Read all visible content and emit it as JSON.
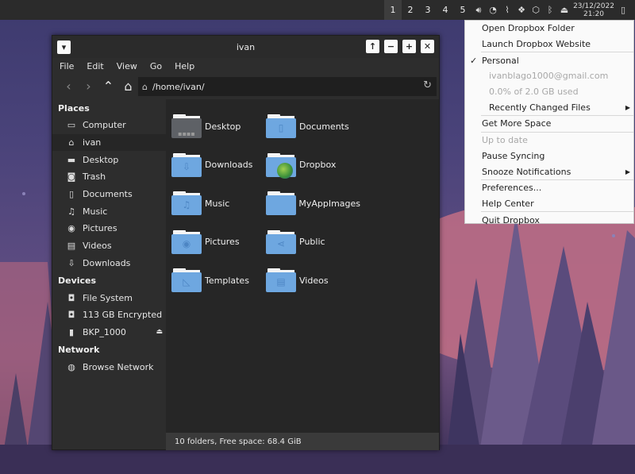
{
  "panel": {
    "workspaces": [
      "1",
      "2",
      "3",
      "4",
      "5"
    ],
    "active_workspace": "1",
    "clock_date": "23/12/2022",
    "clock_time": "21:20",
    "tray_icons": [
      "volume-icon",
      "wifi-icon",
      "paperclip-icon",
      "dropbox-icon",
      "chip-icon",
      "bluetooth-icon",
      "eject-icon",
      "battery-icon"
    ]
  },
  "window": {
    "title": "ivan",
    "menu": [
      "File",
      "Edit",
      "View",
      "Go",
      "Help"
    ],
    "path": "/home/ivan/",
    "status": "10 folders, Free space: 68.4 GiB"
  },
  "sidebar": {
    "places_heading": "Places",
    "places": [
      {
        "label": "Computer",
        "icon": "computer-icon"
      },
      {
        "label": "ivan",
        "icon": "home-icon"
      },
      {
        "label": "Desktop",
        "icon": "desktop-icon"
      },
      {
        "label": "Trash",
        "icon": "trash-icon"
      },
      {
        "label": "Documents",
        "icon": "document-icon"
      },
      {
        "label": "Music",
        "icon": "music-icon"
      },
      {
        "label": "Pictures",
        "icon": "camera-icon"
      },
      {
        "label": "Videos",
        "icon": "film-icon"
      },
      {
        "label": "Downloads",
        "icon": "download-icon"
      }
    ],
    "devices_heading": "Devices",
    "devices": [
      {
        "label": "File System",
        "icon": "drive-icon"
      },
      {
        "label": "113 GB Encrypted",
        "icon": "encrypted-drive-icon"
      },
      {
        "label": "BKP_1000",
        "icon": "usb-drive-icon"
      }
    ],
    "network_heading": "Network",
    "network": [
      {
        "label": "Browse Network",
        "icon": "network-icon"
      }
    ]
  },
  "files": [
    {
      "name": "Desktop",
      "icon": "desktop-folder-icon"
    },
    {
      "name": "Documents",
      "icon": "documents-folder-icon"
    },
    {
      "name": "Downloads",
      "icon": "downloads-folder-icon"
    },
    {
      "name": "Dropbox",
      "icon": "dropbox-folder-icon"
    },
    {
      "name": "Music",
      "icon": "music-folder-icon"
    },
    {
      "name": "MyAppImages",
      "icon": "folder-icon"
    },
    {
      "name": "Pictures",
      "icon": "pictures-folder-icon"
    },
    {
      "name": "Public",
      "icon": "public-folder-icon"
    },
    {
      "name": "Templates",
      "icon": "templates-folder-icon"
    },
    {
      "name": "Videos",
      "icon": "videos-folder-icon"
    }
  ],
  "dropbox_menu": {
    "open_folder": "Open Dropbox Folder",
    "launch_website": "Launch Dropbox Website",
    "personal": "Personal",
    "email": "ivanblago1000@gmail.com",
    "usage": "0.0% of 2.0 GB used",
    "recent": "Recently Changed Files",
    "get_space": "Get More Space",
    "up_to_date": "Up to date",
    "pause": "Pause Syncing",
    "snooze": "Snooze Notifications",
    "preferences": "Preferences...",
    "help": "Help Center",
    "quit": "Quit Dropbox"
  }
}
